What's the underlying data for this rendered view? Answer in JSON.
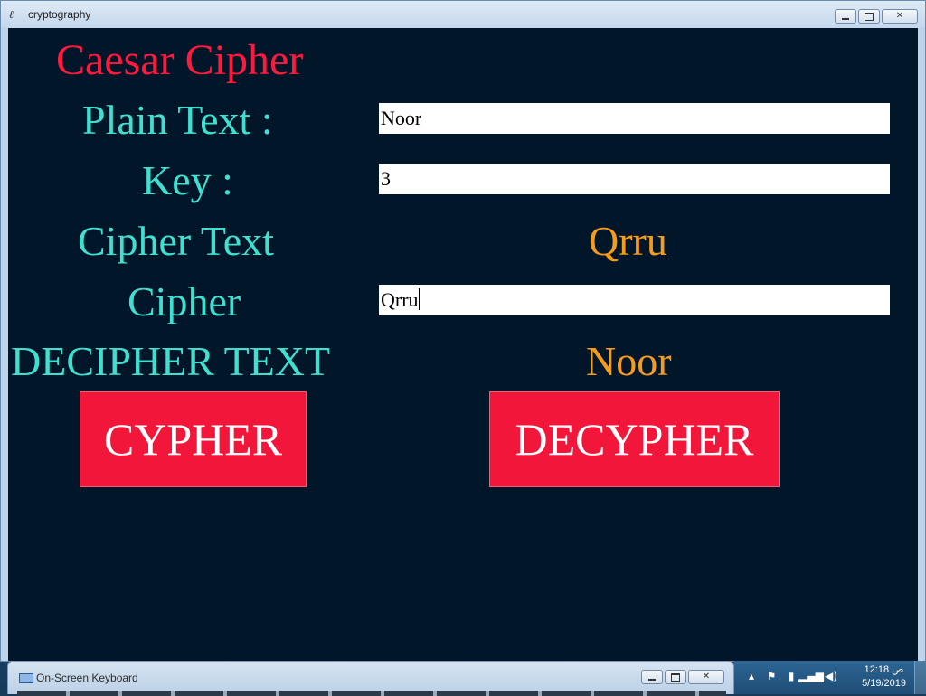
{
  "window": {
    "title": "cryptography"
  },
  "app": {
    "heading": "Caesar Cipher",
    "plain_label": "Plain Text :",
    "plain_value": "Noor",
    "key_label": "Key :",
    "key_value": "3",
    "cipher_text_label": "Cipher Text",
    "cipher_text_result": "Qrru",
    "cipher_label": "Cipher",
    "cipher_value": "Qrru",
    "decipher_label": "DECIPHER TEXT",
    "decipher_result": "Noor",
    "cypher_button": "CYPHER",
    "decypher_button": "DECYPHER"
  },
  "colors": {
    "background": "#021629",
    "heading": "#ff1a3d",
    "label": "#40e0d0",
    "result": "#f79b1c",
    "button": "#f2163a"
  },
  "osk": {
    "title": "On-Screen Keyboard"
  },
  "tray": {
    "time": "12:18 ص",
    "date": "5/19/2019"
  }
}
